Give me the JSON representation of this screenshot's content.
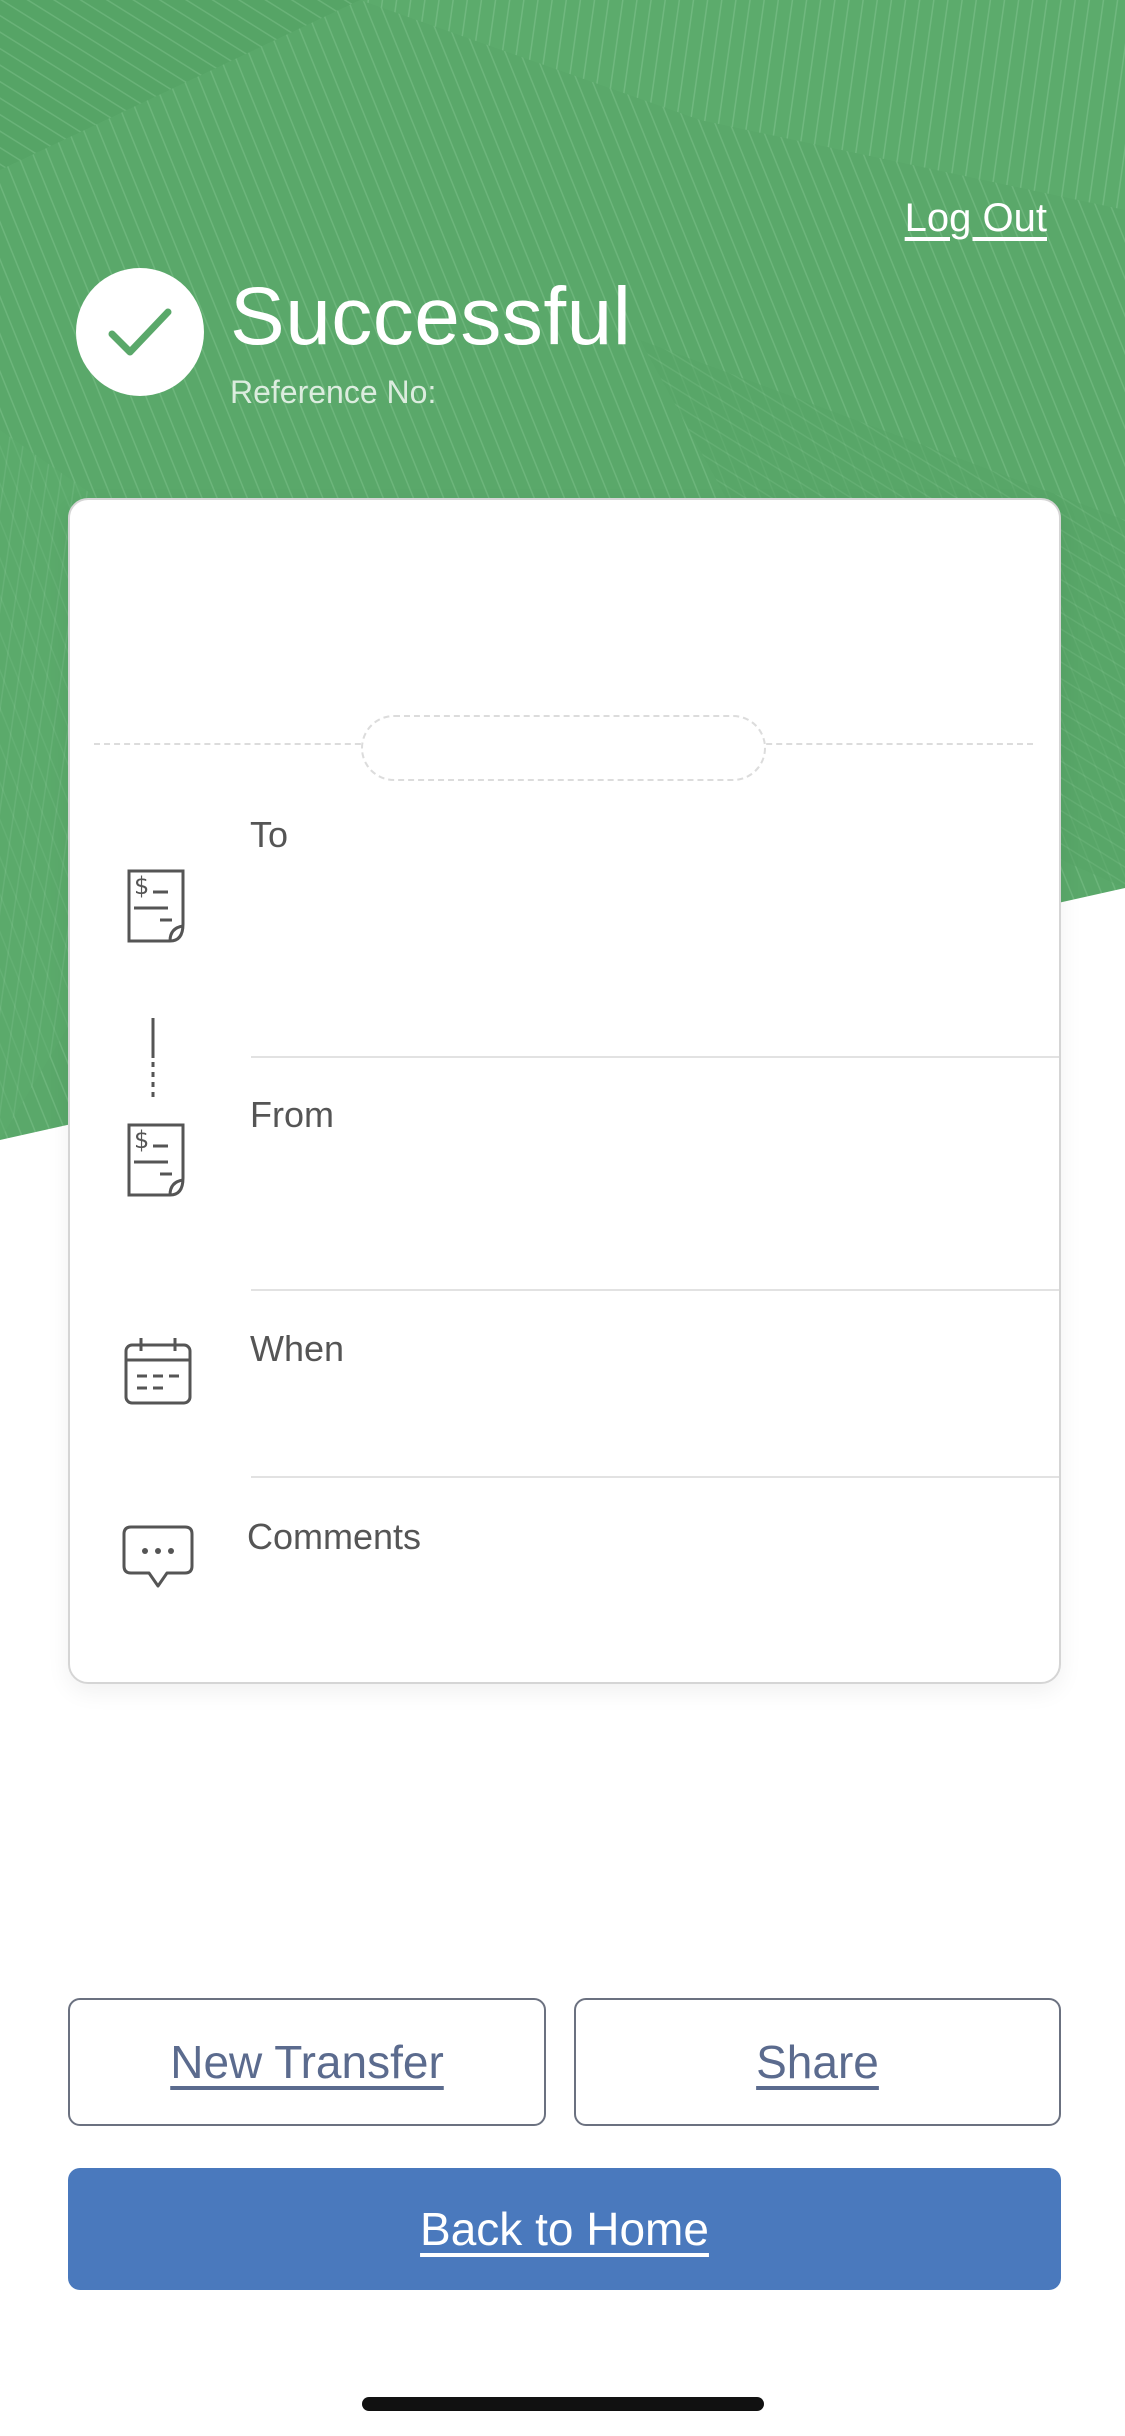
{
  "header": {
    "logout_label": "Log Out",
    "status_title": "Successful",
    "reference_label": "Reference No:"
  },
  "receipt": {
    "to_label": "To",
    "from_label": "From",
    "when_label": "When",
    "comments_label": "Comments"
  },
  "actions": {
    "new_transfer_label": "New Transfer",
    "share_label": "Share",
    "back_home_label": "Back to Home"
  },
  "colors": {
    "header_green": "#5aa86a",
    "primary_blue": "#4a79bd",
    "outline_text": "#5b6b8e"
  },
  "icons": {
    "status": "check-icon",
    "to": "receipt-dollar-icon",
    "from": "receipt-dollar-icon",
    "when": "calendar-icon",
    "comments": "chat-bubble-icon"
  }
}
